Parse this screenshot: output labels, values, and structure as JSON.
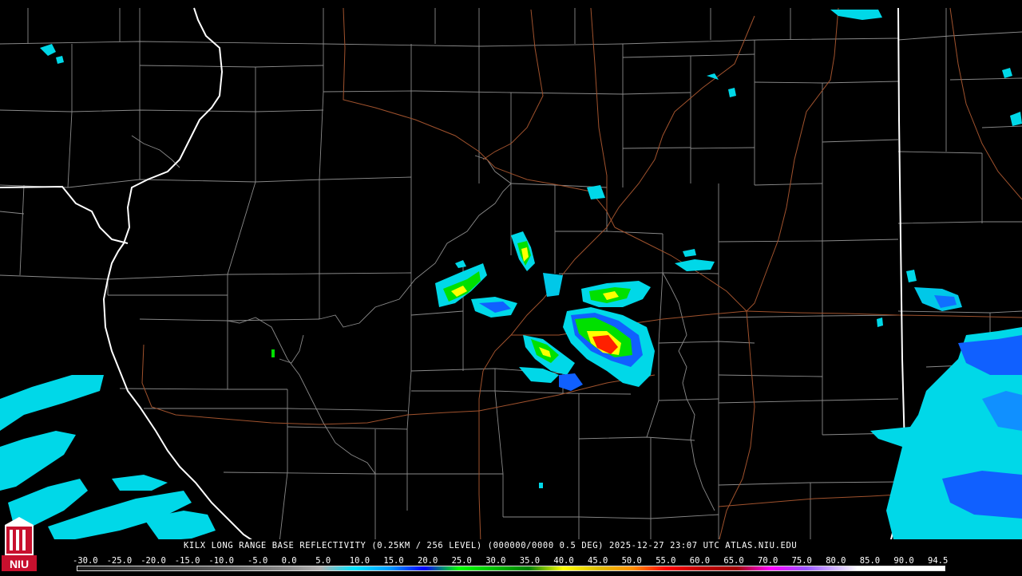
{
  "caption": "KILX LONG RANGE BASE REFLECTIVITY (0.25KM / 256 LEVEL) (000000/0000 0.5 DEG) 2025-12-27 23:07 UTC  ATLAS.NIU.EDU",
  "scale_labels": [
    "-30.0",
    "-25.0",
    "-20.0",
    "-15.0",
    "-10.0",
    "-5.0",
    "0.0",
    "5.0",
    "10.0",
    "15.0",
    "20.0",
    "25.0",
    "30.0",
    "35.0",
    "40.0",
    "45.0",
    "50.0",
    "55.0",
    "60.0",
    "65.0",
    "70.0",
    "75.0",
    "80.0",
    "85.0",
    "90.0",
    "94.5"
  ],
  "logo_text": "NIU",
  "colors": {
    "background": "#000000",
    "county_lines": "#8a8a8a",
    "state_lines": "#ffffff",
    "roads": "#a0522d",
    "light_echo": "#00d8e8",
    "moderate_echo": "#1060ff",
    "strong_echo": "#00e000",
    "heavy_echo": "#ffff00",
    "intense_echo": "#ff2000"
  }
}
